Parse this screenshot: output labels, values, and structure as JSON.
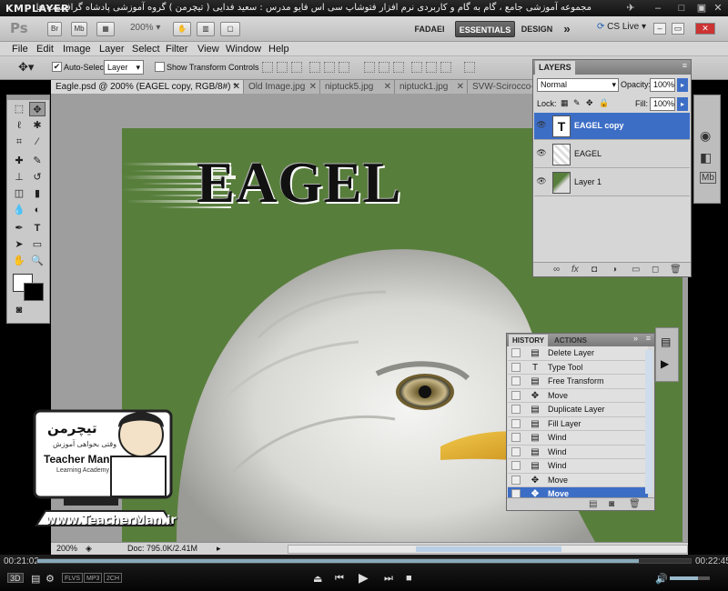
{
  "player": {
    "logo": "KMPLAYER",
    "video_title": "مجموعه آموزشی جامع ، گام به گام و کاربردی نرم افزار فتوشاپ سی اس فایو   مدرس : سعید فدایی ( تیچرمن ) گروه آموزشی پادشاه گرافیست ها",
    "time_elapsed": "00:21:02",
    "time_total": "00:22:45",
    "progress_fraction": 0.92,
    "volume_fraction": 0.7,
    "badges": [
      "3D",
      "FLVS",
      "MP3",
      "2CH"
    ],
    "icons": [
      "pin-icon",
      "minimize-icon",
      "maximize-icon",
      "close-icon",
      "eject-icon",
      "prev-icon",
      "play-icon",
      "next-icon",
      "stop-icon",
      "volume-icon"
    ]
  },
  "ps": {
    "logo": "Ps",
    "appbar_icons": [
      "Br",
      "Mb"
    ],
    "zoom": "200%",
    "workspaces": [
      "FADAEI",
      "ESSENTIALS",
      "DESIGN"
    ],
    "more": "»",
    "cs_live": "CS Live",
    "menu": [
      "File",
      "Edit",
      "Image",
      "Layer",
      "Select",
      "Filter",
      "View",
      "Window",
      "Help"
    ],
    "options": {
      "auto_select_label": "Auto-Select:",
      "auto_select_checked": true,
      "auto_select_value": "Layer",
      "transform_label": "Show Transform Controls",
      "transform_checked": false
    },
    "tabs": [
      "Eagle.psd @ 200% (EAGEL copy, RGB/8#) *",
      "Old Image.jpg",
      "niptuck5.jpg",
      "niptuck1.jpg",
      "SVW-Scirocco-G"
    ],
    "status": {
      "zoom": "200%",
      "doc": "Doc: 795.0K/2.41M"
    },
    "canvas_text": "EAGEL"
  },
  "layers_panel": {
    "title": "LAYERS",
    "blend_mode": "Normal",
    "opacity_label": "Opacity:",
    "opacity": "100%",
    "lock_label": "Lock:",
    "fill_label": "Fill:",
    "fill": "100%",
    "layers": [
      {
        "name": "EAGEL copy",
        "selected": true,
        "thumb": "T"
      },
      {
        "name": "EAGEL",
        "selected": false,
        "thumb": ""
      },
      {
        "name": "Layer 1",
        "selected": false,
        "thumb": ""
      }
    ],
    "footer_icons": [
      "link-icon",
      "fx-icon",
      "mask-icon",
      "adjustment-icon",
      "group-icon",
      "new-layer-icon",
      "trash-icon"
    ]
  },
  "history_panel": {
    "tabs": [
      "HISTORY",
      "ACTIONS"
    ],
    "items": [
      {
        "label": "Delete Layer",
        "icon": "▤"
      },
      {
        "label": "Type Tool",
        "icon": "T"
      },
      {
        "label": "Free Transform",
        "icon": "▤"
      },
      {
        "label": "Move",
        "icon": "✥"
      },
      {
        "label": "Duplicate Layer",
        "icon": "▤"
      },
      {
        "label": "Fill Layer",
        "icon": "▤"
      },
      {
        "label": "Wind",
        "icon": "▤"
      },
      {
        "label": "Wind",
        "icon": "▤"
      },
      {
        "label": "Wind",
        "icon": "▤"
      },
      {
        "label": "Move",
        "icon": "✥"
      },
      {
        "label": "Move",
        "icon": "✥",
        "current": true
      }
    ]
  },
  "watermark": {
    "brand_fa": "تیچرمن",
    "tagline": "وقتی بخواهی آموزش",
    "brand_en": "Teacher Man",
    "sub": "Learning Academy",
    "site": "www.TeacherMan.ir"
  },
  "colors": {
    "canvas_green": "#587e3c",
    "selection_blue": "#3d6ec6",
    "ps_chrome": "#d6d6d6"
  }
}
